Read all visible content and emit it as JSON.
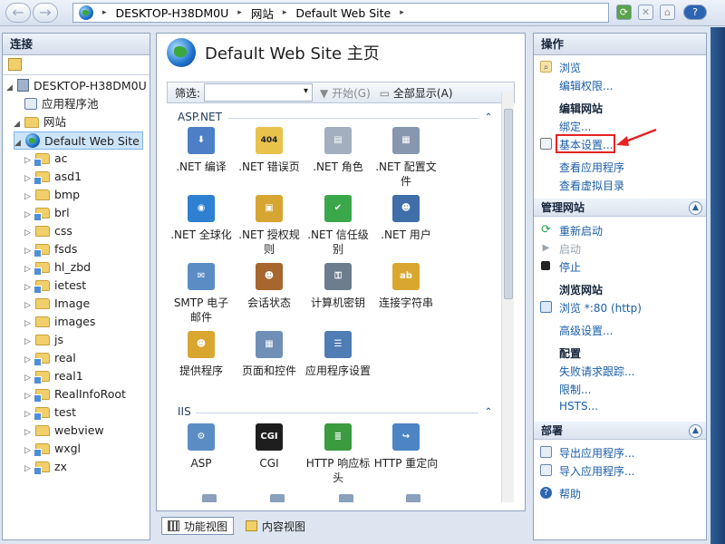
{
  "toolbar": {
    "back_glyph": "←",
    "forward_glyph": "→",
    "address_segments": [
      "DESKTOP-H38DM0U",
      "网站",
      "Default Web Site"
    ],
    "separator": "▸"
  },
  "connections": {
    "title": "连接",
    "tree": [
      {
        "label": "DESKTOP-H38DM0U (D",
        "icon": "server-icon",
        "expanded": true,
        "level": 0
      },
      {
        "label": "应用程序池",
        "icon": "app-pool-icon",
        "level": 1
      },
      {
        "label": "网站",
        "icon": "sites-folder-icon",
        "expanded": true,
        "level": 1
      },
      {
        "label": "Default Web Site",
        "icon": "globe-icon",
        "expanded": true,
        "selected": true,
        "level": 2
      },
      {
        "label": "ac",
        "icon": "app-folder-icon",
        "level": 3
      },
      {
        "label": "asd1",
        "icon": "app-folder-icon",
        "level": 3
      },
      {
        "label": "bmp",
        "icon": "folder-icon",
        "level": 3
      },
      {
        "label": "brl",
        "icon": "app-folder-icon",
        "level": 3
      },
      {
        "label": "css",
        "icon": "folder-icon",
        "level": 3
      },
      {
        "label": "fsds",
        "icon": "app-folder-icon",
        "level": 3
      },
      {
        "label": "hl_zbd",
        "icon": "app-folder-icon",
        "level": 3
      },
      {
        "label": "ietest",
        "icon": "app-folder-icon",
        "level": 3
      },
      {
        "label": "Image",
        "icon": "folder-icon",
        "level": 3
      },
      {
        "label": "images",
        "icon": "folder-icon",
        "level": 3
      },
      {
        "label": "js",
        "icon": "folder-icon",
        "level": 3
      },
      {
        "label": "real",
        "icon": "app-folder-icon",
        "level": 3
      },
      {
        "label": "real1",
        "icon": "app-folder-icon",
        "level": 3
      },
      {
        "label": "RealInfoRoot",
        "icon": "app-folder-icon",
        "level": 3
      },
      {
        "label": "test",
        "icon": "app-folder-icon",
        "level": 3
      },
      {
        "label": "webview",
        "icon": "folder-icon",
        "level": 3
      },
      {
        "label": "wxgl",
        "icon": "app-folder-icon",
        "level": 3
      },
      {
        "label": "zx",
        "icon": "app-folder-icon",
        "level": 3
      }
    ]
  },
  "main": {
    "title": "Default Web Site 主页",
    "filter": {
      "label": "筛选:",
      "start_label": "开始(G)",
      "showall_label": "全部显示(A)"
    },
    "sections": [
      {
        "name": "ASP.NET",
        "features": [
          {
            "label": ".NET 编译",
            "icon": "net-compile-icon"
          },
          {
            "label": ".NET 错误页",
            "icon": "net-error-pages-icon"
          },
          {
            "label": ".NET 角色",
            "icon": "net-roles-icon"
          },
          {
            "label": ".NET 配置文件",
            "icon": "net-profile-icon"
          },
          {
            "label": ".NET 全球化",
            "icon": "net-globalization-icon"
          },
          {
            "label": ".NET 授权规则",
            "icon": "net-authorization-icon"
          },
          {
            "label": ".NET 信任级别",
            "icon": "net-trust-icon"
          },
          {
            "label": ".NET 用户",
            "icon": "net-users-icon"
          },
          {
            "label": "SMTP 电子邮件",
            "icon": "smtp-icon"
          },
          {
            "label": "会话状态",
            "icon": "session-state-icon"
          },
          {
            "label": "计算机密钥",
            "icon": "machine-key-icon"
          },
          {
            "label": "连接字符串",
            "icon": "connection-strings-icon"
          },
          {
            "label": "提供程序",
            "icon": "providers-icon"
          },
          {
            "label": "页面和控件",
            "icon": "pages-controls-icon"
          },
          {
            "label": "应用程序设置",
            "icon": "app-settings-icon"
          }
        ]
      },
      {
        "name": "IIS",
        "features": [
          {
            "label": "ASP",
            "icon": "asp-icon"
          },
          {
            "label": "CGI",
            "icon": "cgi-icon"
          },
          {
            "label": "HTTP 响应标头",
            "icon": "http-headers-icon"
          },
          {
            "label": "HTTP 重定向",
            "icon": "http-redirect-icon"
          }
        ]
      }
    ],
    "cgi_text": "CGI",
    "error_icon_text": "404",
    "ab_text": "ab",
    "tabs": {
      "features": "功能视图",
      "content": "内容视图"
    }
  },
  "actions": {
    "title": "操作",
    "items_top": [
      {
        "label": "浏览",
        "type": "link"
      },
      {
        "label": "编辑权限...",
        "type": "link"
      }
    ],
    "edit_site": "编辑网站",
    "bindings": "绑定...",
    "basic_settings": "基本设置...",
    "view_apps": "查看应用程序",
    "view_vdirs": "查看虚拟目录",
    "manage_site": "管理网站",
    "restart": "重新启动",
    "start": "启动",
    "stop": "停止",
    "browse_site": "浏览网站",
    "browse_port": "浏览 *:80 (http)",
    "advanced": "高级设置...",
    "config": "配置",
    "failed_tracing": "失败请求跟踪...",
    "limits": "限制...",
    "hsts": "HSTS...",
    "deploy": "部署",
    "export_app": "导出应用程序...",
    "import_app": "导入应用程序...",
    "help": "帮助"
  },
  "colors": {
    "highlight_box": "#e52323",
    "link": "#1a5ea8",
    "selection": "#cce4f7"
  }
}
